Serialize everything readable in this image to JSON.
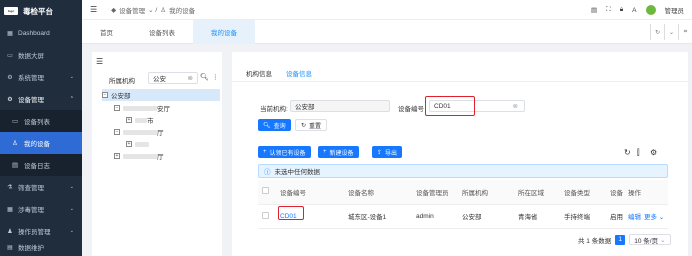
{
  "app": {
    "title": "毒检平台",
    "logo_text": "logo"
  },
  "sidebar": {
    "items": [
      {
        "label": "Dashboard",
        "icon": "grid-icon"
      },
      {
        "label": "数据大屏",
        "icon": "monitor-icon"
      },
      {
        "label": "系统管理",
        "icon": "gear-icon"
      },
      {
        "label": "设备管理",
        "icon": "device-icon"
      },
      {
        "label": "设备列表",
        "icon": "list-icon"
      },
      {
        "label": "我的设备",
        "icon": "my-device-icon"
      },
      {
        "label": "设备日志",
        "icon": "log-icon"
      },
      {
        "label": "筛查管理",
        "icon": "filter-icon"
      },
      {
        "label": "涉毒管理",
        "icon": "shield-icon"
      },
      {
        "label": "操作员管理",
        "icon": "user-icon"
      },
      {
        "label": "数据维护",
        "icon": "database-icon"
      }
    ]
  },
  "breadcrumb": [
    "设备管理",
    "我的设备"
  ],
  "topbar": {
    "user": "管理员"
  },
  "tabs": [
    "首页",
    "设备列表",
    "我的设备"
  ],
  "tree": {
    "label": "所属机构",
    "search_value": "公安",
    "nodes": [
      "公安部",
      "安厅",
      "市",
      "厅",
      "厅"
    ]
  },
  "subtabs": [
    "机构信息",
    "设备信息"
  ],
  "form": {
    "org_label": "当前机构:",
    "org_value": "公安部",
    "id_label": "设备编号",
    "id_value": "CD01",
    "search_btn": "查询",
    "reset_btn": "重置"
  },
  "toolbar": {
    "btn1": "认领已有设备",
    "btn2": "新建设备",
    "btn3": "导出"
  },
  "notice": "未选中任何数据",
  "table": {
    "headers": [
      "设备编号",
      "设备名称",
      "设备管理员",
      "所属机构",
      "所在区域",
      "设备类型",
      "设备",
      "操作"
    ],
    "rows": [
      [
        "CD01",
        "城东区-设备1",
        "admin",
        "公安部",
        "青海省",
        "手持终端",
        "启用",
        "编辑",
        "更多"
      ]
    ]
  },
  "pagination": {
    "total": "共 1 条数据",
    "page": "1",
    "size": "10 条/页"
  },
  "colors": {
    "accent": "#1677ff",
    "sidebar": "#1f2d3d",
    "active": "#2f6bd4",
    "highlight": "#e0202b"
  }
}
